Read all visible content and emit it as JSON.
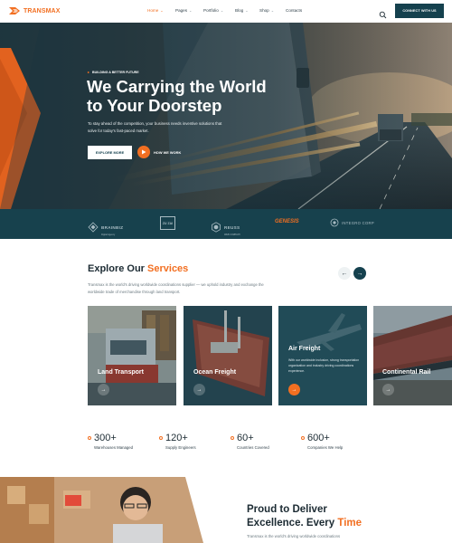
{
  "brand": {
    "name": "TRANSMAX",
    "accent": "#f26f21",
    "dark": "#15414e"
  },
  "nav": {
    "items": [
      {
        "label": "Home",
        "dropdown": true,
        "active": true
      },
      {
        "label": "Pages",
        "dropdown": true
      },
      {
        "label": "Portfolio",
        "dropdown": true
      },
      {
        "label": "Blog",
        "dropdown": true
      },
      {
        "label": "Shop",
        "dropdown": true
      },
      {
        "label": "Contacts",
        "dropdown": false
      }
    ],
    "search_icon": "search-icon",
    "cta": "CONNECT WITH US"
  },
  "hero": {
    "eyebrow": "BUILDING A BETTER FUTURE",
    "title_line1": "We Carrying the World",
    "title_line2": "to Your Doorstep",
    "subtitle": "To stay ahead of the competition, your business needs inventive solutions that solve for today's fast-paced market.",
    "primary_button": "EXPLORE MORE",
    "video_label": "HOW WE WORK"
  },
  "partners": [
    {
      "name": "BRAINBIZ",
      "tag": "Digital Agency"
    },
    {
      "name": "ZU ZAI",
      "tag": ""
    },
    {
      "name": "REUSS",
      "tag": "WEB COMPANY"
    },
    {
      "name": "GENESIS",
      "tag": ""
    },
    {
      "name": "INTEGRO CORP",
      "tag": ""
    }
  ],
  "services": {
    "title_plain": "Explore Our",
    "title_accent": "Services",
    "subtitle": "Transmax is the world's driving worldwide coordinations supplier — we uphold industry and exchange the worldwide trade of merchandise through land transport.",
    "prev_icon": "arrow-left-icon",
    "next_icon": "arrow-right-icon",
    "cards": [
      {
        "title": "Land Transport",
        "description": ""
      },
      {
        "title": "Ocean Freight",
        "description": ""
      },
      {
        "title": "Air Freight",
        "description": "With our worldwide inclusion, strong transportation organization and industry driving coordinations experience."
      },
      {
        "title": "Continental Rail",
        "description": ""
      }
    ]
  },
  "stats": [
    {
      "value": "300+",
      "label": "Warehouses Managed"
    },
    {
      "value": "120+",
      "label": "Supply Engineers"
    },
    {
      "value": "60+",
      "label": "Countries Covered"
    },
    {
      "value": "600+",
      "label": "Companies We Help"
    }
  ],
  "about": {
    "title_line1": "Proud to Deliver",
    "title_line2_plain": "Excellence. Every",
    "title_line2_accent": "Time",
    "subtitle": "Transmax is the world's driving worldwide coordinations"
  }
}
